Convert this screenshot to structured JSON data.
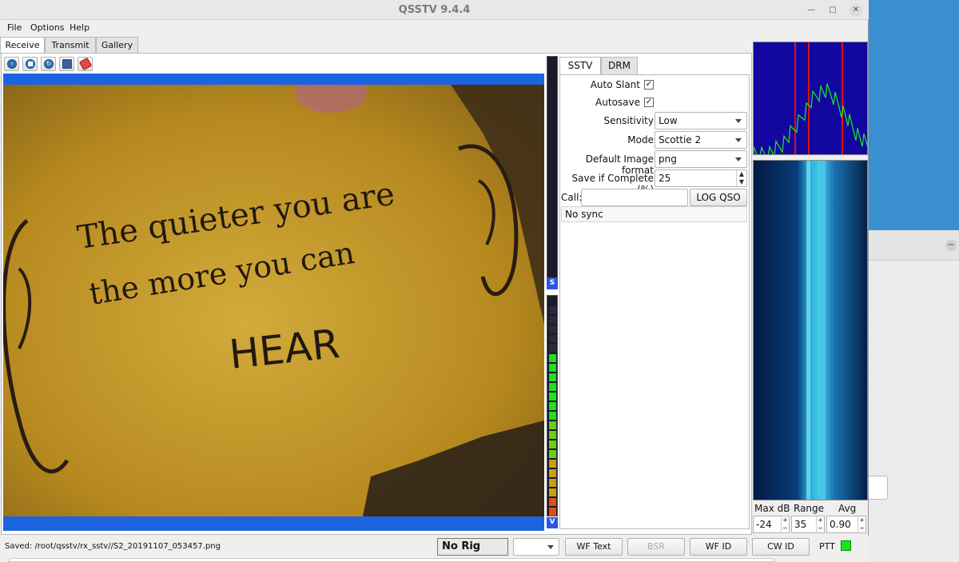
{
  "window": {
    "title": "QSSTV 9.4.4"
  },
  "window_controls": {
    "minimize": "—",
    "maximize": "□",
    "close": "✕"
  },
  "menu": [
    "File",
    "Options",
    "Help"
  ],
  "tabs": [
    "Receive",
    "Transmit",
    "Gallery"
  ],
  "active_tab": "Receive",
  "toolbar_icons": [
    "start-icon",
    "stop-icon",
    "resync-icon",
    "save-icon",
    "erase-icon"
  ],
  "image_text": {
    "line1": "The quieter you are",
    "line2": "the more you can",
    "line3": "HEAR"
  },
  "vu_labels": {
    "signal": "S",
    "volume": "V"
  },
  "inner_tabs": [
    "SSTV",
    "DRM"
  ],
  "sstv": {
    "auto_slant_label": "Auto Slant",
    "auto_slant": "✓",
    "autosave_label": "Autosave",
    "autosave": "✓",
    "sensitivity_label": "Sensitivity",
    "sensitivity": "Low",
    "mode_label": "Mode",
    "mode": "Scottie 2",
    "format_label": "Default Image format",
    "format": "png",
    "save_complete_label": "Save if Complete (%)",
    "save_complete": "25",
    "call_label": "Call:",
    "call_value": "",
    "log_qso": "LOG QSO",
    "sync_status": "No sync"
  },
  "waterfall": {
    "maxdb_label": "Max dB",
    "range_label": "Range",
    "avg_label": "Avg",
    "maxdb": "-24",
    "range": "35",
    "avg": "0.90"
  },
  "status": {
    "saved": "Saved: /root/qsstv/rx_sstv//S2_20191107_053457.png",
    "rig": "No Rig",
    "wf_text": "WF Text",
    "bsr": "BSR",
    "wf_id": "WF ID",
    "cw_id": "CW ID",
    "ptt": "PTT"
  },
  "colors": {
    "accent": "#1d63e0",
    "ptt_on": "#19e619",
    "spectrum": "#1208a0",
    "spectrum_line": "#22e822",
    "marker": "#e01010"
  }
}
